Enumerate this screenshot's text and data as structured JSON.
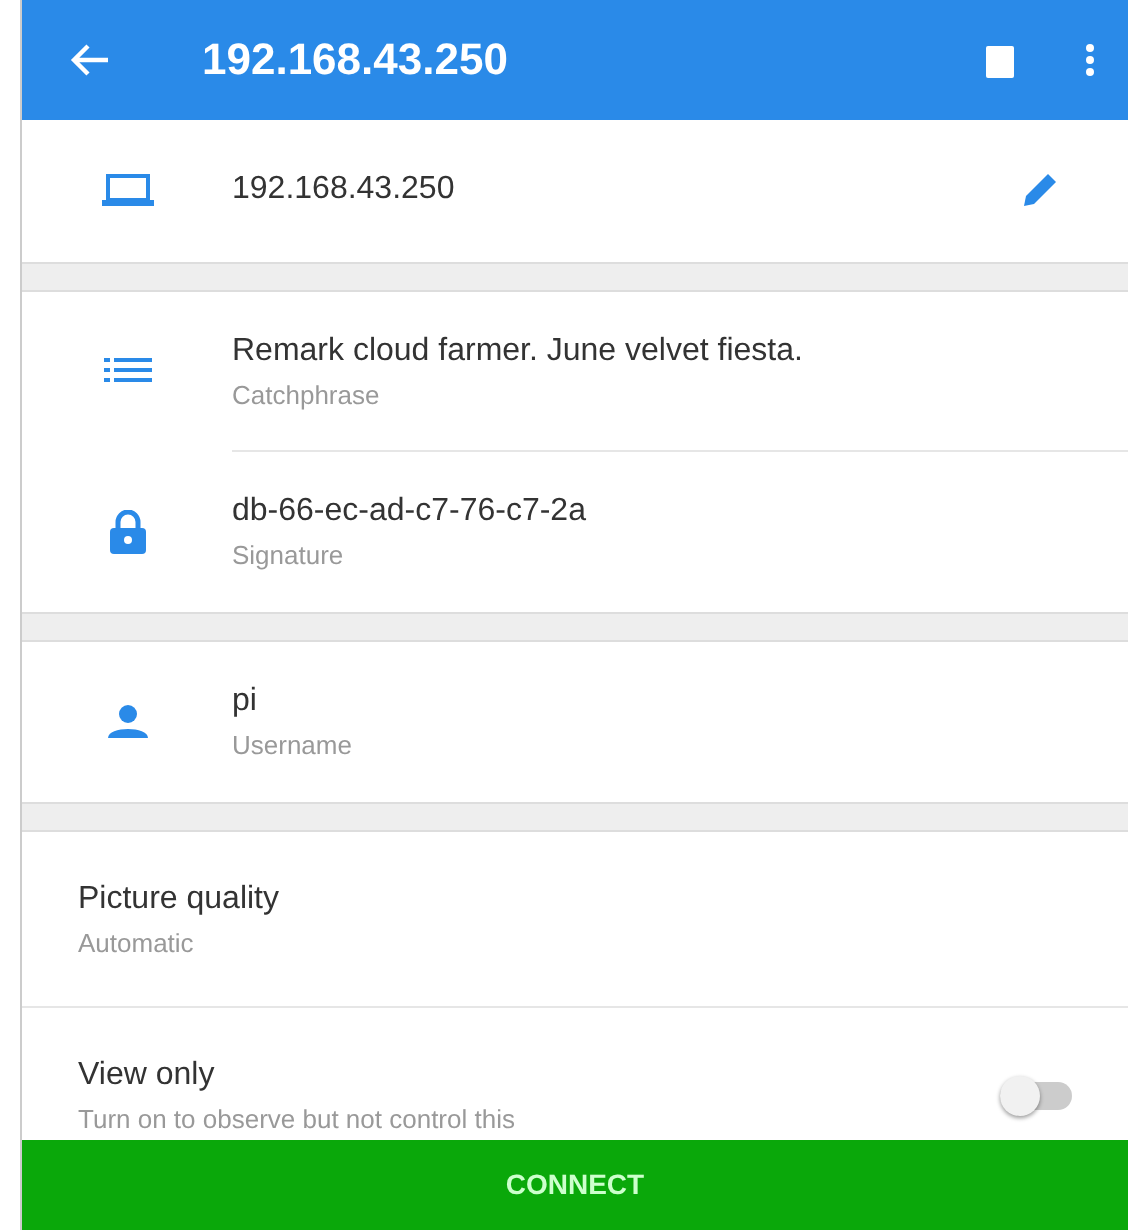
{
  "app_bar": {
    "title": "192.168.43.250"
  },
  "host": {
    "address": "192.168.43.250"
  },
  "details": [
    {
      "kind": "catchphrase",
      "value": "Remark cloud farmer. June velvet fiesta.",
      "label": "Catchphrase"
    },
    {
      "kind": "signature",
      "value": "db-66-ec-ad-c7-76-c7-2a",
      "label": "Signature"
    }
  ],
  "user": {
    "value": "pi",
    "label": "Username"
  },
  "settings": [
    {
      "kind": "choice",
      "title": "Picture quality",
      "subtitle": "Automatic"
    },
    {
      "kind": "toggle",
      "title": "View only",
      "subtitle": "Turn on to observe but not control this",
      "on": false
    }
  ],
  "connect_button": "CONNECT"
}
